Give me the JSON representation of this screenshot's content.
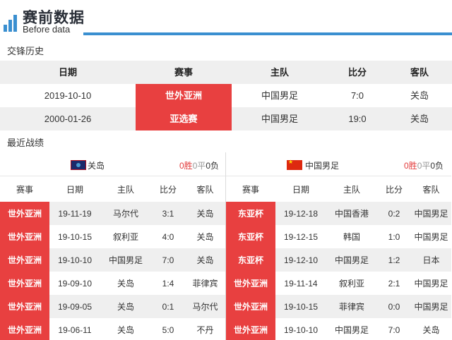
{
  "header": {
    "title": "赛前数据",
    "subtitle": "Before data",
    "accent_color": "#3a8fd0"
  },
  "history": {
    "section_label": "交锋历史",
    "columns": [
      "日期",
      "赛事",
      "主队",
      "比分",
      "客队"
    ],
    "rows": [
      {
        "date": "2019-10-10",
        "competition": "世外亚洲",
        "home": "中国男足",
        "score": "7:0",
        "away": "关岛"
      },
      {
        "date": "2000-01-26",
        "competition": "亚选赛",
        "home": "中国男足",
        "score": "19:0",
        "away": "关岛"
      }
    ]
  },
  "recent": {
    "section_label": "最近战绩",
    "columns": [
      "赛事",
      "日期",
      "主队",
      "比分",
      "客队"
    ],
    "left": {
      "team": "关岛",
      "flag_icon": "guam-flag-icon",
      "wins": "0胜",
      "draws": "0平",
      "losses": "0负",
      "rows": [
        {
          "competition": "世外亚洲",
          "date": "19-11-19",
          "home": "马尔代",
          "score": "3:1",
          "away": "关岛"
        },
        {
          "competition": "世外亚洲",
          "date": "19-10-15",
          "home": "叙利亚",
          "score": "4:0",
          "away": "关岛"
        },
        {
          "competition": "世外亚洲",
          "date": "19-10-10",
          "home": "中国男足",
          "score": "7:0",
          "away": "关岛"
        },
        {
          "competition": "世外亚洲",
          "date": "19-09-10",
          "home": "关岛",
          "score": "1:4",
          "away": "菲律宾"
        },
        {
          "competition": "世外亚洲",
          "date": "19-09-05",
          "home": "关岛",
          "score": "0:1",
          "away": "马尔代"
        },
        {
          "competition": "世外亚洲",
          "date": "19-06-11",
          "home": "关岛",
          "score": "5:0",
          "away": "不丹"
        }
      ]
    },
    "right": {
      "team": "中国男足",
      "flag_icon": "china-flag-icon",
      "wins": "0胜",
      "draws": "0平",
      "losses": "0负",
      "rows": [
        {
          "competition": "东亚杯",
          "date": "19-12-18",
          "home": "中国香港",
          "score": "0:2",
          "away": "中国男足"
        },
        {
          "competition": "东亚杯",
          "date": "19-12-15",
          "home": "韩国",
          "score": "1:0",
          "away": "中国男足"
        },
        {
          "competition": "东亚杯",
          "date": "19-12-10",
          "home": "中国男足",
          "score": "1:2",
          "away": "日本"
        },
        {
          "competition": "世外亚洲",
          "date": "19-11-14",
          "home": "叙利亚",
          "score": "2:1",
          "away": "中国男足"
        },
        {
          "competition": "世外亚洲",
          "date": "19-10-15",
          "home": "菲律宾",
          "score": "0:0",
          "away": "中国男足"
        },
        {
          "competition": "世外亚洲",
          "date": "19-10-10",
          "home": "中国男足",
          "score": "7:0",
          "away": "关岛"
        }
      ]
    }
  },
  "colors": {
    "badge": "#e84040",
    "win": "#e23b3b",
    "row_alt": "#efefef"
  }
}
